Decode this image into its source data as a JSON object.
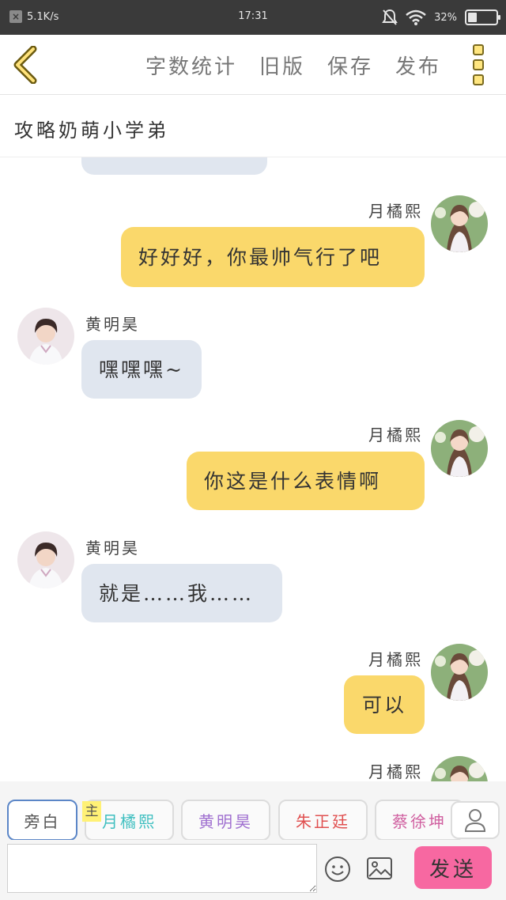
{
  "status_bar": {
    "net_speed": "5.1K/s",
    "time": "17:31",
    "battery": "32%",
    "battery_level": 0.32
  },
  "toolbar": {
    "actions": [
      "字数统计",
      "旧版",
      "保存",
      "发布"
    ]
  },
  "title": "攻略奶萌小学弟",
  "messages": [
    {
      "side": "left",
      "sender": "",
      "text": ""
    },
    {
      "side": "right",
      "sender": "月橘熙",
      "text": "好好好，你最帅气行了吧"
    },
    {
      "side": "left",
      "sender": "黄明昊",
      "text": "嘿嘿嘿~"
    },
    {
      "side": "right",
      "sender": "月橘熙",
      "text": "你这是什么表情啊"
    },
    {
      "side": "left",
      "sender": "黄明昊",
      "text": "就是……我……"
    },
    {
      "side": "right",
      "sender": "月橘熙",
      "text": "可以"
    },
    {
      "side": "right",
      "sender": "月橘熙",
      "text": ""
    }
  ],
  "roles": {
    "main_tag": "主",
    "items": [
      {
        "label": "旁白",
        "color": "#555555"
      },
      {
        "label": "月橘熙",
        "color": "#3fbfc0"
      },
      {
        "label": "黄明昊",
        "color": "#a070d0"
      },
      {
        "label": "朱正廷",
        "color": "#e05050"
      },
      {
        "label": "蔡徐坤",
        "color": "#d060a0"
      }
    ]
  },
  "input": {
    "placeholder": "",
    "send_label": "发送"
  },
  "colors": {
    "left_bubble": "#e0e6ef",
    "right_bubble": "#fad86b",
    "send": "#f768a1"
  }
}
